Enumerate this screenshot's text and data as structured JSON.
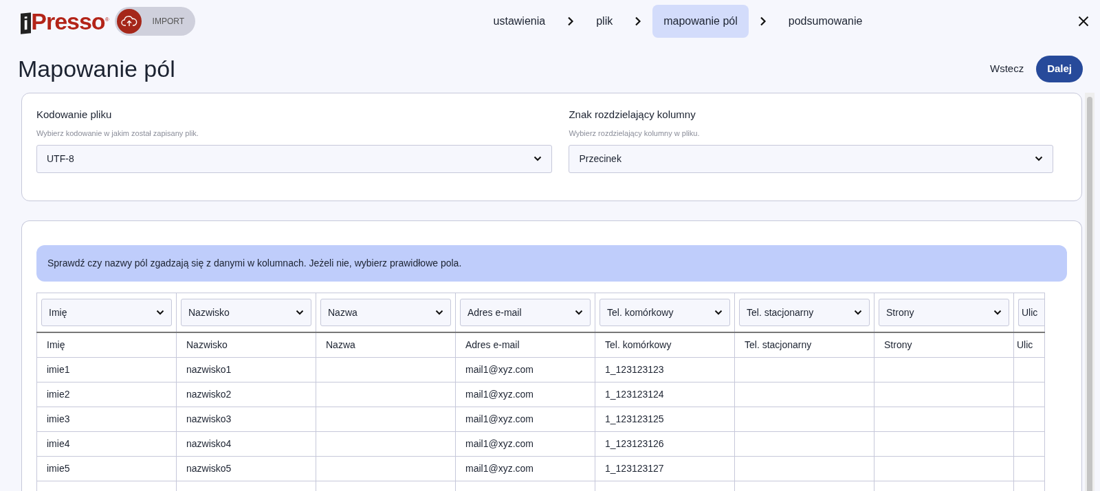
{
  "logo": {
    "mark": "i",
    "wordmark": "Presso",
    "registered": "®",
    "badge": "IMPORT"
  },
  "steps": [
    {
      "label": "ustawienia",
      "selected": false
    },
    {
      "label": "plik",
      "selected": false
    },
    {
      "label": "mapowanie pól",
      "selected": true
    },
    {
      "label": "podsumowanie",
      "selected": false
    }
  ],
  "page_title": "Mapowanie pól",
  "actions": {
    "back": "Wstecz",
    "next": "Dalej"
  },
  "settings": [
    {
      "label": "Kodowanie pliku",
      "hint": "Wybierz kodowanie w jakim został zapisany plik.",
      "value": "UTF-8"
    },
    {
      "label": "Znak rozdzielający kolumny",
      "hint": "Wybierz rozdzielający kolumny w pliku.",
      "value": "Przecinek"
    }
  ],
  "alert": "Sprawdź czy nazwy pól zgadzają się z danymi w kolumnach. Jeżeli nie, wybierz prawidłowe pola.",
  "table": {
    "columns": [
      {
        "mapping": "Imię",
        "heading": "Imię"
      },
      {
        "mapping": "Nazwisko",
        "heading": "Nazwisko"
      },
      {
        "mapping": "Nazwa",
        "heading": "Nazwa"
      },
      {
        "mapping": "Adres e-mail",
        "heading": "Adres e-mail"
      },
      {
        "mapping": "Tel. komórkowy",
        "heading": "Tel. komórkowy"
      },
      {
        "mapping": "Tel. stacjonarny",
        "heading": "Tel. stacjonarny"
      },
      {
        "mapping": "Strony",
        "heading": "Strony"
      },
      {
        "mapping": "Ulic",
        "heading": "Ulic"
      }
    ],
    "rows": [
      {
        "col_1": "imie1",
        "col_2": "nazwisko1",
        "col_4": "mail1@xyz.com",
        "col_5": "1_123123123"
      },
      {
        "col_1": "imie2",
        "col_2": "nazwisko2",
        "col_4": "mail1@xyz.com",
        "col_5": "1_123123124"
      },
      {
        "col_1": "imie3",
        "col_2": "nazwisko3",
        "col_4": "mail1@xyz.com",
        "col_5": "1_123123125"
      },
      {
        "col_1": "imie4",
        "col_2": "nazwisko4",
        "col_4": "mail1@xyz.com",
        "col_5": "1_123123126"
      },
      {
        "col_1": "imie5",
        "col_2": "nazwisko5",
        "col_4": "mail1@xyz.com",
        "col_5": "1_123123127"
      }
    ]
  }
}
